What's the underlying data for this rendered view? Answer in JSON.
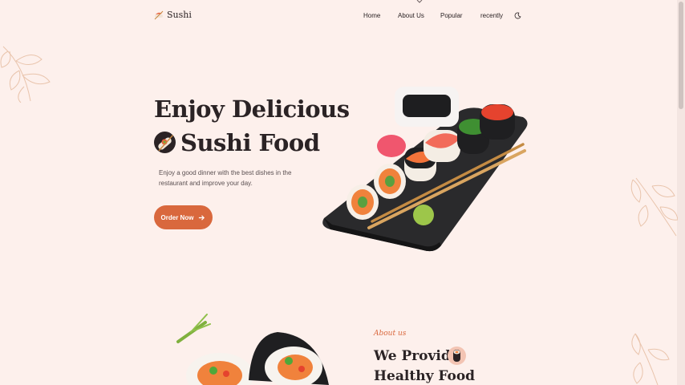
{
  "header": {
    "logo_text": "Sushi",
    "nav": {
      "home": "Home",
      "about": "About Us",
      "popular": "Popular",
      "recently": "recently"
    }
  },
  "hero": {
    "title_line1": "Enjoy Delicious",
    "title_line2": "Sushi Food",
    "description": "Enjoy a good dinner with the best dishes in the restaurant and improve your day.",
    "cta_label": "Order Now"
  },
  "about": {
    "kicker": "About us",
    "title_line1": "We Provide",
    "title_line2": "Healthy Food"
  },
  "colors": {
    "background": "#fdf0ec",
    "accent": "#d9683d",
    "text": "#2b2325"
  },
  "icons": [
    "sushi-logo-icon",
    "moon-icon",
    "arrow-right-icon",
    "sushi-roll-icon",
    "leaf-decoration-icon"
  ]
}
